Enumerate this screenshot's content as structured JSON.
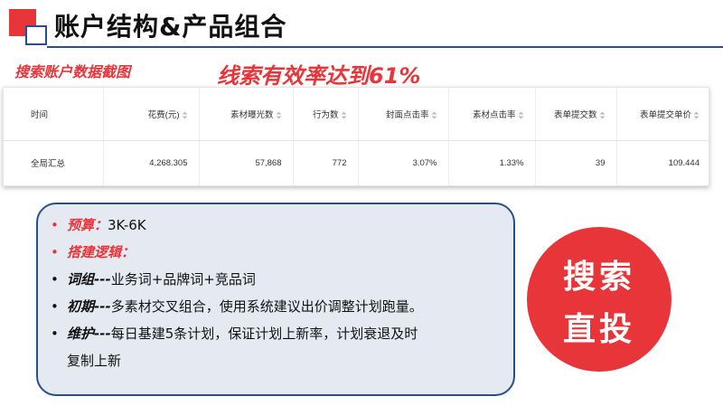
{
  "page": {
    "title": "账户结构&产品组合",
    "caption": "搜索账户数据截图",
    "headline": "线索有效率达到61%"
  },
  "table": {
    "headers": [
      "时间",
      "花费(元)",
      "素材曝光数",
      "行为数",
      "封面点击率",
      "素材点击率",
      "表单提交数",
      "表单提交单价"
    ],
    "row": [
      "全局汇总",
      "4,268.305",
      "57,868",
      "772",
      "3.07%",
      "1.33%",
      "39",
      "109.444"
    ]
  },
  "strategy": {
    "budget_label": "预算：",
    "budget_value": "3K-6K",
    "logic_label": "搭建逻辑：",
    "items": [
      {
        "label": "词组",
        "sep": "---",
        "text": "业务词+品牌词+竞品词"
      },
      {
        "label": "初期",
        "sep": "---",
        "text": "多素材交叉组合，使用系统建议出价调整计划跑量。"
      },
      {
        "label": "维护",
        "sep": "---",
        "text": "每日基建5条计划，保证计划上新率，计划衰退及时",
        "text2": "复制上新"
      }
    ]
  },
  "badge": {
    "line1": "搜索",
    "line2": "直投"
  },
  "colors": {
    "accent_red": "#e8353a",
    "navy": "#2a4f86",
    "panel_bg": "#e5eaf2"
  },
  "icons": {
    "sort": "sort-icon",
    "bullet": "bullet-dot"
  }
}
